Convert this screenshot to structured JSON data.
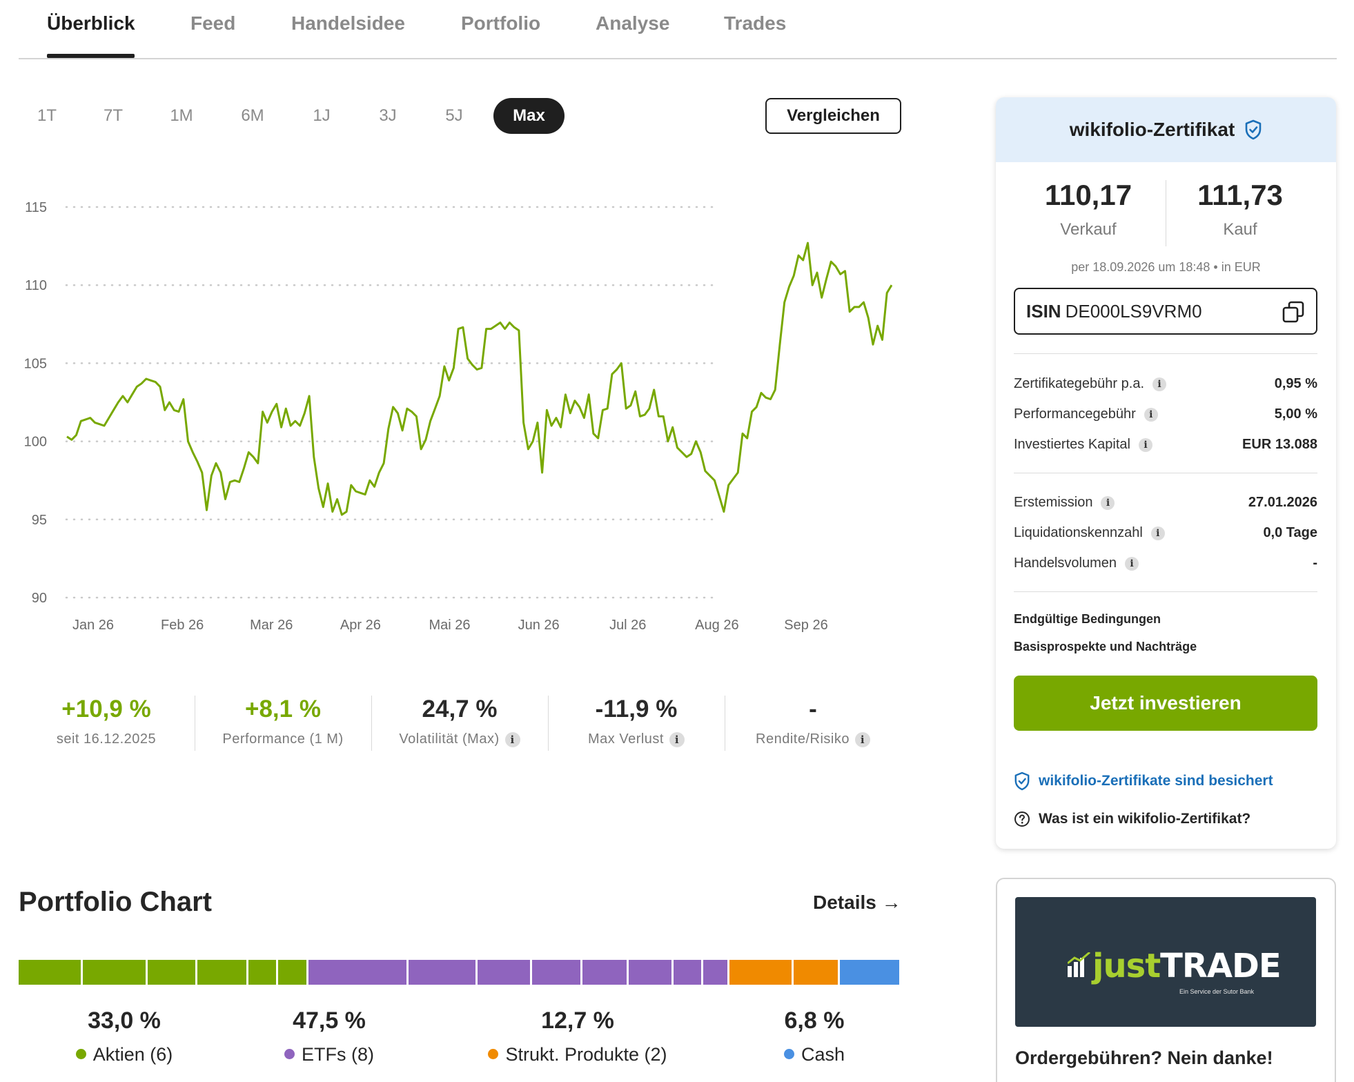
{
  "tabs": [
    {
      "label": "Überblick",
      "active": true
    },
    {
      "label": "Feed"
    },
    {
      "label": "Handelsidee"
    },
    {
      "label": "Portfolio"
    },
    {
      "label": "Analyse"
    },
    {
      "label": "Trades"
    }
  ],
  "ranges": [
    "1T",
    "7T",
    "1M",
    "6M",
    "1J",
    "3J",
    "5J",
    "Max"
  ],
  "active_range": "Max",
  "compare_label": "Vergleichen",
  "chart_data": {
    "type": "line",
    "x_tick_labels": [
      "Jan 26",
      "Feb 26",
      "Mar 26",
      "Apr 26",
      "Mai 26",
      "Jun 26",
      "Jul 26",
      "Aug 26",
      "Sep 26"
    ],
    "y_ticks": [
      115,
      110,
      105,
      100,
      95,
      90
    ],
    "ylim": [
      90,
      115
    ],
    "grid": "dotted horizontal",
    "line_color": "#78a800",
    "series": [
      {
        "values": [
          100.3,
          100.1,
          100.4,
          101.3,
          101.4,
          101.5,
          101.2,
          101.1,
          101.0,
          101.5,
          102.0,
          102.5,
          102.9,
          102.5,
          103.0,
          103.5,
          103.7,
          104.0,
          103.9,
          103.8,
          103.5,
          102.0,
          102.5,
          102.0,
          101.9,
          102.7,
          100.0,
          99.3,
          98.7,
          98.0,
          95.6,
          97.8,
          98.6,
          98.0,
          96.3,
          97.4,
          97.5,
          97.4,
          98.3,
          99.3,
          99.0,
          98.6,
          101.9,
          101.2,
          101.9,
          102.4,
          100.9,
          102.1,
          101.0,
          101.3,
          101.0,
          101.8,
          102.9,
          99.0,
          97.0,
          95.8,
          97.3,
          95.5,
          96.3,
          95.3,
          95.5,
          97.2,
          96.8,
          96.7,
          96.6,
          97.5,
          97.1,
          98.0,
          98.6,
          100.8,
          102.2,
          101.8,
          100.7,
          102.1,
          101.9,
          101.6,
          99.5,
          100.1,
          101.3,
          102.1,
          102.9,
          104.8,
          103.9,
          104.7,
          107.2,
          107.3,
          105.3,
          104.9,
          104.6,
          104.7,
          107.2,
          107.2,
          107.4,
          107.6,
          107.2,
          107.6,
          107.3,
          107.1,
          101.2,
          99.5,
          100.0,
          101.2,
          98.0,
          102.0,
          101.0,
          101.5,
          100.9,
          103.0,
          101.8,
          102.6,
          102.2,
          101.5,
          103.0,
          100.5,
          100.2,
          102.0,
          102.1,
          104.3,
          104.6,
          105.0,
          102.1,
          102.3,
          103.2,
          101.6,
          101.7,
          102.1,
          103.3,
          101.6,
          101.6,
          100.0,
          100.9,
          99.6,
          99.3,
          99.0,
          99.2,
          100.0,
          99.3,
          98.1,
          97.8,
          97.5,
          96.5,
          95.5,
          97.2,
          97.6,
          98.0,
          100.5,
          100.2,
          101.9,
          102.2,
          103.1,
          102.8,
          102.7,
          103.3,
          106.2,
          108.9,
          109.9,
          110.6,
          111.9,
          111.6,
          112.7,
          110.0,
          110.8,
          109.2,
          110.4,
          111.5,
          111.2,
          110.7,
          110.9,
          108.3,
          108.6,
          108.6,
          108.9,
          107.9,
          106.2,
          107.4,
          106.5,
          109.5,
          110.0
        ]
      }
    ]
  },
  "stats": [
    {
      "value": "+10,9 %",
      "label": "seit 16.12.2025",
      "color": "#78a800"
    },
    {
      "value": "+8,1 %",
      "label": "Performance (1 M)",
      "color": "#78a800"
    },
    {
      "value": "24,7 %",
      "label": "Volatilität (Max)",
      "info": true
    },
    {
      "value": "-11,9 %",
      "label": "Max Verlust",
      "info": true
    },
    {
      "value": "-",
      "label": "Rendite/Risiko",
      "info": true
    }
  ],
  "portfolio_chart": {
    "title": "Portfolio Chart",
    "details_label": "Details →",
    "segments": [
      {
        "color": "#78a800",
        "weight": 7.0
      },
      {
        "color": "#78a800",
        "weight": 7.0
      },
      {
        "color": "#78a800",
        "weight": 5.4
      },
      {
        "color": "#78a800",
        "weight": 5.5
      },
      {
        "color": "#78a800",
        "weight": 3.1
      },
      {
        "color": "#78a800",
        "weight": 3.2
      },
      {
        "color": "#8f64be",
        "weight": 11.0
      },
      {
        "color": "#8f64be",
        "weight": 7.5
      },
      {
        "color": "#8f64be",
        "weight": 5.9
      },
      {
        "color": "#8f64be",
        "weight": 5.4
      },
      {
        "color": "#8f64be",
        "weight": 5.0
      },
      {
        "color": "#8f64be",
        "weight": 4.8
      },
      {
        "color": "#8f64be",
        "weight": 3.1
      },
      {
        "color": "#8f64be",
        "weight": 2.7
      },
      {
        "color": "#f08a00",
        "weight": 7.0
      },
      {
        "color": "#f08a00",
        "weight": 4.9
      },
      {
        "color": "#4a90e2",
        "weight": 6.7
      }
    ],
    "allocations": [
      {
        "value": "33,0 %",
        "label": "Aktien (6)",
        "color": "#78a800"
      },
      {
        "value": "47,5 %",
        "label": "ETFs (8)",
        "color": "#8f64be"
      },
      {
        "value": "12,7 %",
        "label": "Strukt. Produkte (2)",
        "color": "#f08a00"
      },
      {
        "value": "6,8 %",
        "label": "Cash",
        "color": "#4a90e2"
      }
    ]
  },
  "certificate": {
    "title": "wikifolio-Zertifikat",
    "bid_value": "110,17",
    "bid_label": "Verkauf",
    "ask_value": "111,73",
    "ask_label": "Kauf",
    "price_note": "per 18.09.2026 um 18:48 • in EUR",
    "isin_label": "ISIN",
    "isin_value": "DE000LS9VRM0",
    "rows_a": [
      {
        "label": "Zertifikategebühr p.a.",
        "value": "0,95 %"
      },
      {
        "label": "Performancegebühr",
        "value": "5,00 %"
      },
      {
        "label": "Investiertes Kapital",
        "value": "EUR 13.088"
      }
    ],
    "rows_b": [
      {
        "label": "Erstemission",
        "value": "27.01.2026"
      },
      {
        "label": "Liquidationskennzahl",
        "value": "0,0 Tage"
      },
      {
        "label": "Handelsvolumen",
        "value": "-"
      }
    ],
    "link_terms": "Endgültige Bedingungen",
    "link_prospectus": "Basisprospekte und Nachträge",
    "invest_label": "Jetzt investieren",
    "secured_label": "wikifolio-Zertifikate sind besichert",
    "what_is_label": "Was ist ein wikifolio-Zertifikat?",
    "accent": "#78a800",
    "link_blue": "#1a6fb8"
  },
  "ad": {
    "logo_just": "just",
    "logo_trade": "TRADE",
    "logo_sub": "Ein Service der Sutor Bank",
    "title": "Ordergebühren? Nein danke!"
  }
}
